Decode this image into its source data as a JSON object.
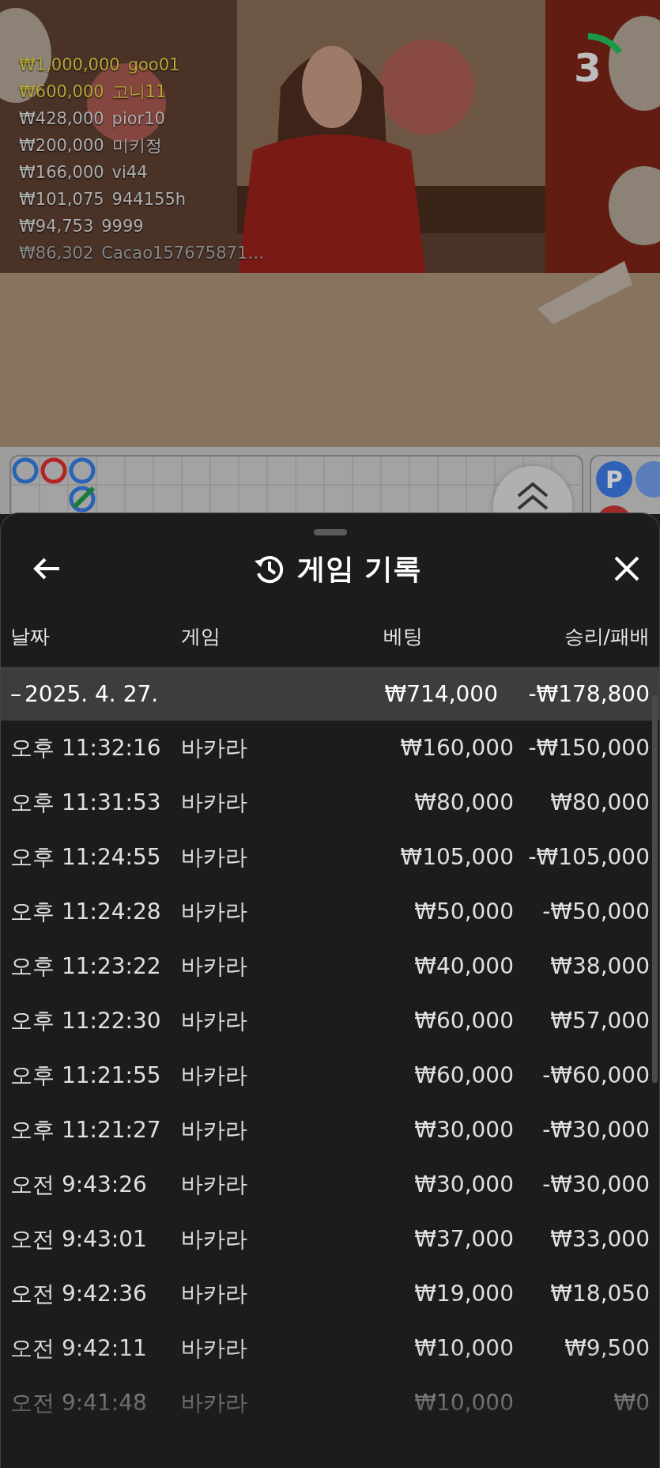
{
  "video": {
    "timer": {
      "value": "3"
    },
    "winners": [
      {
        "amount": "₩1,000,000",
        "name": "goo01",
        "color": "#b8a83a"
      },
      {
        "amount": "₩600,000",
        "name": "고니11",
        "color": "#b8a83a"
      },
      {
        "amount": "₩428,000",
        "name": "pior10",
        "color": "#b0b0b0"
      },
      {
        "amount": "₩200,000",
        "name": "미키정",
        "color": "#b0b0b0"
      },
      {
        "amount": "₩166,000",
        "name": "vi44",
        "color": "#b0b0b0"
      },
      {
        "amount": "₩101,075",
        "name": "944155h",
        "color": "#b0b0b0"
      },
      {
        "amount": "₩94,753",
        "name": "9999",
        "color": "#b0b0b0"
      },
      {
        "amount": "₩86,302",
        "name": "Cacao157675871…",
        "color": "#888888"
      }
    ]
  },
  "roadmap": {
    "bead": "P"
  },
  "sheet": {
    "title": "게임 기록",
    "columns": [
      "날짜",
      "게임",
      "베팅",
      "승리/패배"
    ],
    "date_group": {
      "toggle": "–",
      "date": "2025. 4. 27.",
      "bet": "₩714,000",
      "result": "-₩178,800"
    },
    "rows": [
      {
        "time": "오후 11:32:16",
        "game": "바카라",
        "bet": "₩160,000",
        "result": "-₩150,000"
      },
      {
        "time": "오후 11:31:53",
        "game": "바카라",
        "bet": "₩80,000",
        "result": "₩80,000"
      },
      {
        "time": "오후 11:24:55",
        "game": "바카라",
        "bet": "₩105,000",
        "result": "-₩105,000"
      },
      {
        "time": "오후 11:24:28",
        "game": "바카라",
        "bet": "₩50,000",
        "result": "-₩50,000"
      },
      {
        "time": "오후 11:23:22",
        "game": "바카라",
        "bet": "₩40,000",
        "result": "₩38,000"
      },
      {
        "time": "오후 11:22:30",
        "game": "바카라",
        "bet": "₩60,000",
        "result": "₩57,000"
      },
      {
        "time": "오후 11:21:55",
        "game": "바카라",
        "bet": "₩60,000",
        "result": "-₩60,000"
      },
      {
        "time": "오후 11:21:27",
        "game": "바카라",
        "bet": "₩30,000",
        "result": "-₩30,000"
      },
      {
        "time": "오전 9:43:26",
        "game": "바카라",
        "bet": "₩30,000",
        "result": "-₩30,000"
      },
      {
        "time": "오전 9:43:01",
        "game": "바카라",
        "bet": "₩37,000",
        "result": "₩33,000"
      },
      {
        "time": "오전 9:42:36",
        "game": "바카라",
        "bet": "₩19,000",
        "result": "₩18,050"
      },
      {
        "time": "오전 9:42:11",
        "game": "바카라",
        "bet": "₩10,000",
        "result": "₩9,500"
      },
      {
        "time": "오전 9:41:48",
        "game": "바카라",
        "bet": "₩10,000",
        "result": "₩0"
      }
    ]
  }
}
